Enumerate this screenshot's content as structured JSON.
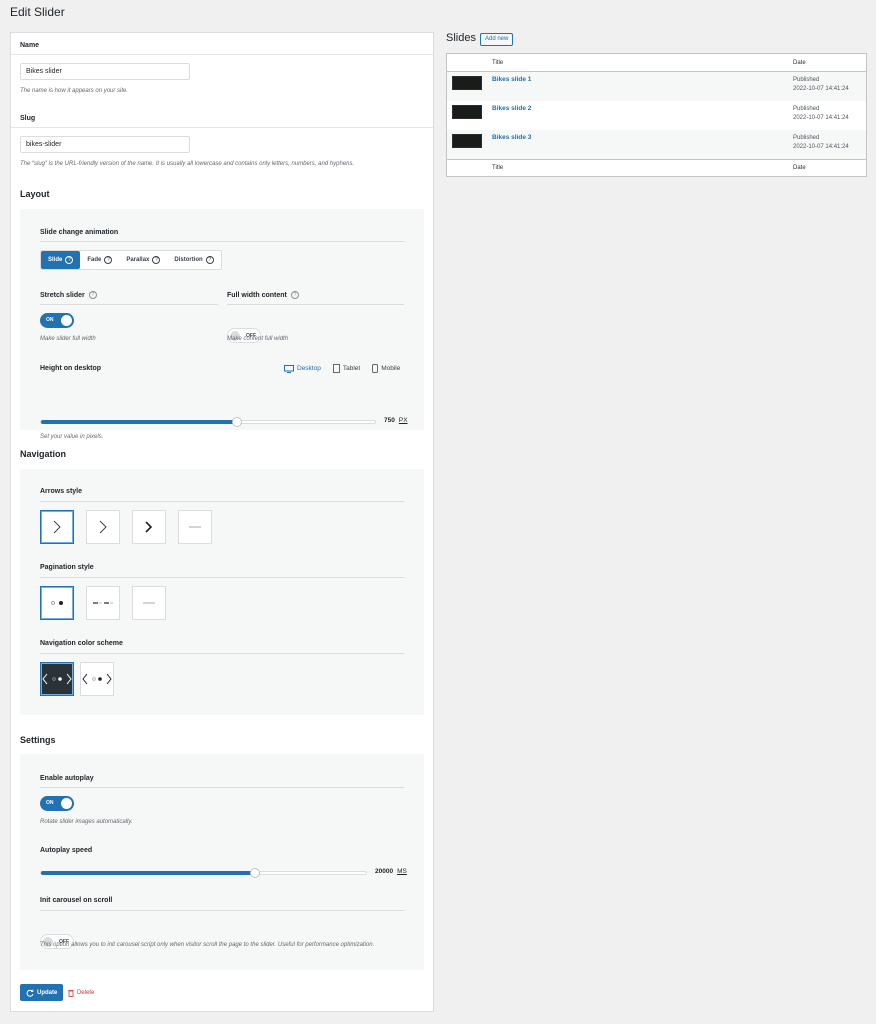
{
  "page": {
    "title": "Edit Slider"
  },
  "name_field": {
    "label": "Name",
    "value": "Bikes slider",
    "help": "The name is how it appears on your site."
  },
  "slug_field": {
    "label": "Slug",
    "value": "bikes-slider",
    "help": "The “slug” is the URL-friendly version of the name. It is usually all lowercase and contains only letters, numbers, and hyphens."
  },
  "layout": {
    "title": "Layout",
    "animation_label": "Slide change animation",
    "animation_options": [
      "Slide",
      "Fade",
      "Parallax",
      "Distortion"
    ],
    "animation_selected": "Slide",
    "stretch": {
      "label": "Stretch slider",
      "state": "ON",
      "help": "Make slider full width"
    },
    "fullwidth": {
      "label": "Full width content",
      "state": "OFF",
      "help": "Make content full width"
    },
    "height": {
      "label": "Height on desktop",
      "value": "750",
      "unit": "PX",
      "help": "Set your value in pixels.",
      "fraction": 0.586
    },
    "devices": [
      "Desktop",
      "Tablet",
      "Mobile"
    ]
  },
  "navigation": {
    "title": "Navigation",
    "arrows_label": "Arrows style",
    "pagination_label": "Pagination style",
    "color_label": "Navigation color scheme"
  },
  "settings": {
    "title": "Settings",
    "autoplay": {
      "label": "Enable autoplay",
      "state": "ON",
      "help": "Rotate slider images automatically."
    },
    "speed": {
      "label": "Autoplay speed",
      "value": "20000",
      "unit": "MS",
      "fraction": 0.658
    },
    "init": {
      "label": "Init carousel on scroll",
      "state": "OFF",
      "help": "This option allows you to init carousel script only when visitor scroll the page to the slider. Useful for performance optimization."
    }
  },
  "actions": {
    "update": "Update",
    "delete": "Delete"
  },
  "slides": {
    "title": "Slides",
    "add_new": "Add new",
    "col_title": "Title",
    "col_date": "Date",
    "rows": [
      {
        "title": "Bikes slide 1",
        "status": "Published",
        "date": "2022-10-07 14:41:24"
      },
      {
        "title": "Bikes slide 2",
        "status": "Published",
        "date": "2022-10-07 14:41:24"
      },
      {
        "title": "Bikes slide 3",
        "status": "Published",
        "date": "2022-10-07 14:41:24"
      }
    ]
  },
  "colors": {
    "accent": "#2271b1",
    "danger": "#d63638",
    "panel": "#f6f7f7"
  }
}
